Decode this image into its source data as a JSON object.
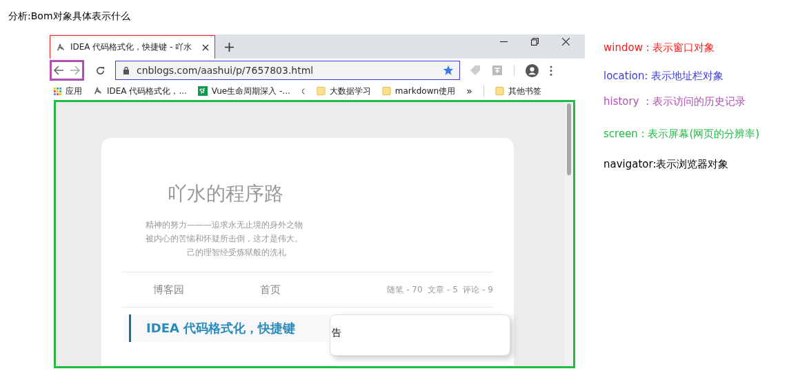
{
  "heading": "分析:Bom对象具体表示什么",
  "browser": {
    "tab": {
      "title": "IDEA 代码格式化，快捷键 - 吖水"
    },
    "address": "cnblogs.com/aashui/p/7657803.html",
    "bookmarks": [
      {
        "kind": "apps",
        "label": "应用"
      },
      {
        "kind": "page",
        "label": "IDEA 代码格式化，..."
      },
      {
        "kind": "sf",
        "label": "Vue生命周期深入 -..."
      },
      {
        "kind": "cut"
      },
      {
        "kind": "folder",
        "label": "大数据学习"
      },
      {
        "kind": "folder",
        "label": "markdown使用"
      }
    ],
    "more": "»",
    "other_bookmarks": "其他书签"
  },
  "page": {
    "blog_title": "吖水的程序路",
    "motto": [
      "精神的努力———追求永无止境的身外之物",
      "被内心的苦恼和怀疑所击倒，这才是伟大。",
      "己的理智经受炼狱般的洗礼"
    ],
    "nav": [
      "博客园",
      "首页"
    ],
    "stats": "随笔 - 70  文章 - 5  评论 - 9",
    "post_title": "IDEA 代码格式化，快捷键",
    "panel_text": "告"
  },
  "notes": [
    {
      "term": "window",
      "text": " : 表示窗口对象",
      "color": "#ff1a1a"
    },
    {
      "term": "location",
      "text": ": 表示地址栏对象",
      "color": "#3b3bdb"
    },
    {
      "term": "history",
      "text": "  : 表示访问的历史记录",
      "color": "#b14fb5"
    },
    {
      "term": "screen",
      "text": " : 表示屏幕(网页的分辨率)",
      "color": "#22bb44"
    },
    {
      "term": "navigator",
      "text": ":表示浏览器对象",
      "color": "#000000"
    }
  ]
}
